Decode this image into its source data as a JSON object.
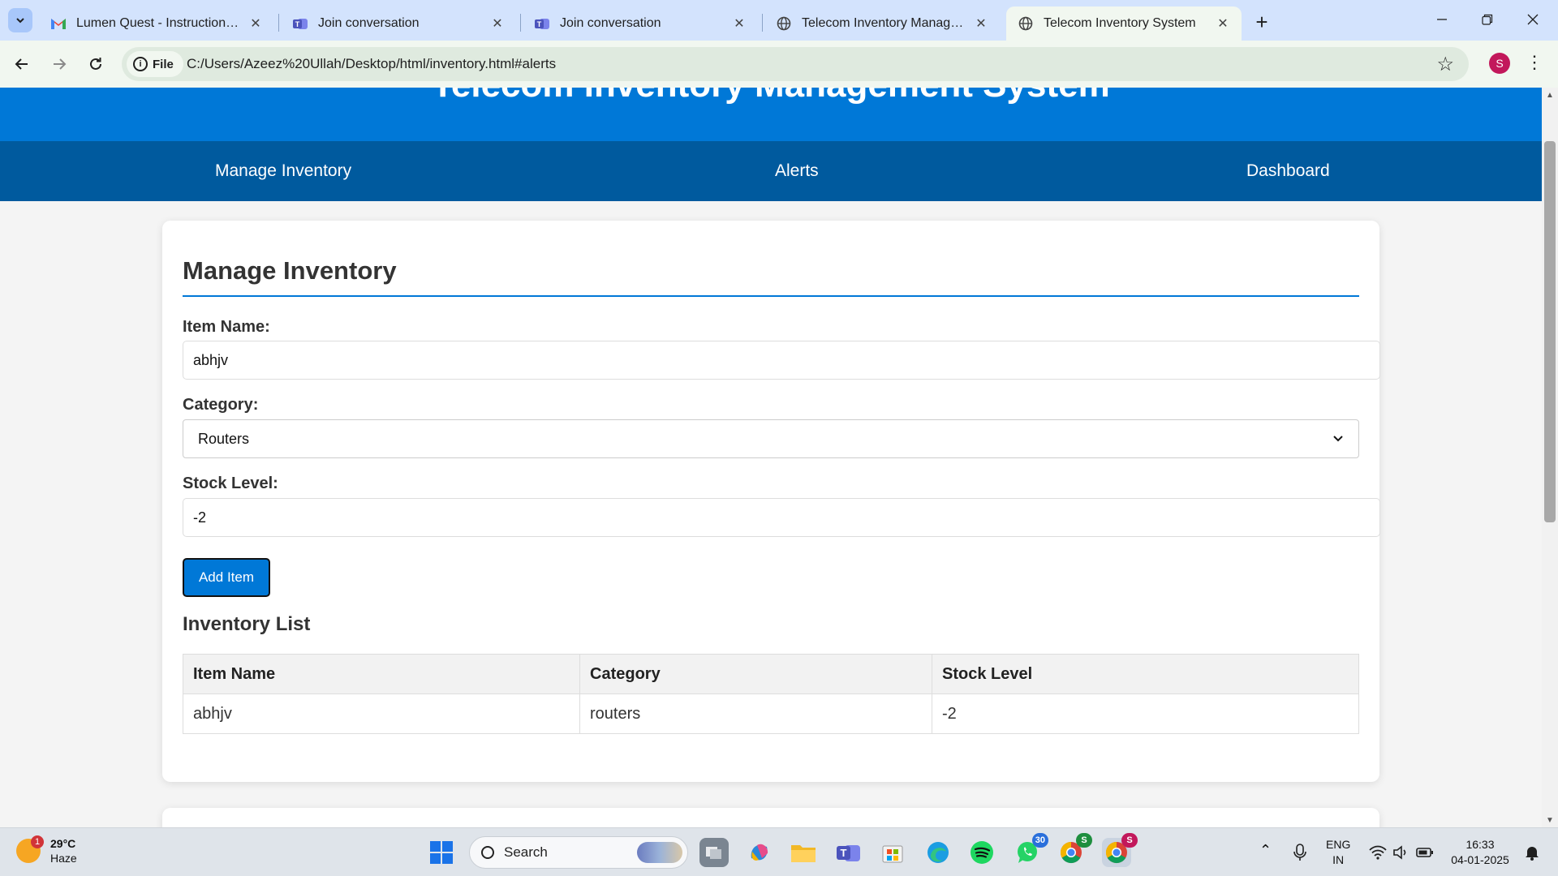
{
  "browser": {
    "tabs": [
      {
        "title": "Lumen Quest - Instructions and",
        "icon": "gmail-icon",
        "active": false
      },
      {
        "title": "Join conversation",
        "icon": "teams-icon",
        "active": false
      },
      {
        "title": "Join conversation",
        "icon": "teams-icon",
        "active": false
      },
      {
        "title": "Telecom Inventory Managemen",
        "icon": "globe-icon",
        "active": false
      },
      {
        "title": "Telecom Inventory System",
        "icon": "globe-icon",
        "active": true
      }
    ],
    "address": {
      "scheme_label": "File",
      "url": "C:/Users/Azeez%20Ullah/Desktop/html/inventory.html#alerts"
    },
    "profile_initial": "S"
  },
  "site": {
    "header_title": "Telecom Inventory Management System",
    "nav": [
      "Manage Inventory",
      "Alerts",
      "Dashboard"
    ],
    "colors": {
      "header": "#0078d7",
      "nav": "#005a9e",
      "accent": "#0078d7"
    }
  },
  "form": {
    "section_title": "Manage Inventory",
    "item_name_label": "Item Name:",
    "item_name_value": "abhjv",
    "category_label": "Category:",
    "category_value": "Routers",
    "stock_label": "Stock Level:",
    "stock_value": "-2",
    "add_button": "Add Item"
  },
  "inventory": {
    "title": "Inventory List",
    "columns": [
      "Item Name",
      "Category",
      "Stock Level"
    ],
    "rows": [
      [
        "abhjv",
        "routers",
        "-2"
      ]
    ]
  },
  "taskbar": {
    "weather_temp": "29°C",
    "weather_desc": "Haze",
    "weather_badge": "1",
    "search_label": "Search",
    "whatsapp_badge": "30",
    "chrome_badge": "S",
    "lang_top": "ENG",
    "lang_bottom": "IN",
    "time": "16:33",
    "date": "04-01-2025"
  }
}
